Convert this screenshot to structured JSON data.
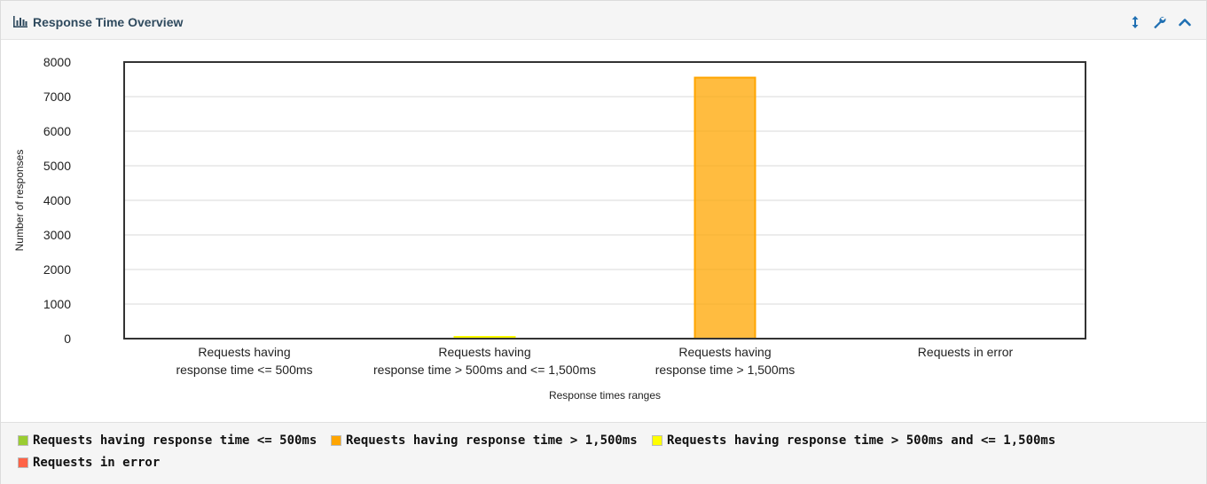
{
  "panel": {
    "title": "Response Time Overview",
    "icons": {
      "title": "bar-chart-icon",
      "expand": "vertical-arrows-icon",
      "settings": "wrench-icon",
      "collapse": "chevron-up-icon"
    },
    "accent_color": "#1f6fb2"
  },
  "chart_data": {
    "type": "bar",
    "title": "",
    "xlabel": "Response times ranges",
    "ylabel": "Number of responses",
    "ylim": [
      0,
      8000
    ],
    "yticks": [
      "0",
      "1000",
      "2000",
      "3000",
      "4000",
      "5000",
      "6000",
      "7000",
      "8000"
    ],
    "grid": true,
    "categories": [
      [
        "Requests having",
        "response time <= 500ms"
      ],
      [
        "Requests having",
        "response time > 500ms and <= 1,500ms"
      ],
      [
        "Requests having",
        "response time > 1,500ms"
      ],
      [
        "Requests in error"
      ]
    ],
    "series": [
      {
        "name": "Requests having response time <= 500ms",
        "color": "#9acd32",
        "values": [
          0,
          0,
          0,
          0
        ]
      },
      {
        "name": "Requests having response time > 500ms and <= 1,500ms",
        "color": "#ffff00",
        "values": [
          0,
          8,
          0,
          0
        ]
      },
      {
        "name": "Requests having response time > 1,500ms",
        "color": "#ffa500",
        "values": [
          0,
          0,
          7550,
          0
        ]
      },
      {
        "name": "Requests in error",
        "color": "#ff6347",
        "values": [
          0,
          0,
          0,
          0
        ]
      }
    ],
    "legend_position": "bottom"
  },
  "legend": {
    "items": [
      {
        "label": "Requests having response time <= 500ms",
        "color": "#9acd32"
      },
      {
        "label": "Requests having response time > 1,500ms",
        "color": "#ffa500"
      },
      {
        "label": "Requests having response time > 500ms and <= 1,500ms",
        "color": "#ffff00"
      },
      {
        "label": "Requests in error",
        "color": "#ff6347"
      }
    ]
  }
}
